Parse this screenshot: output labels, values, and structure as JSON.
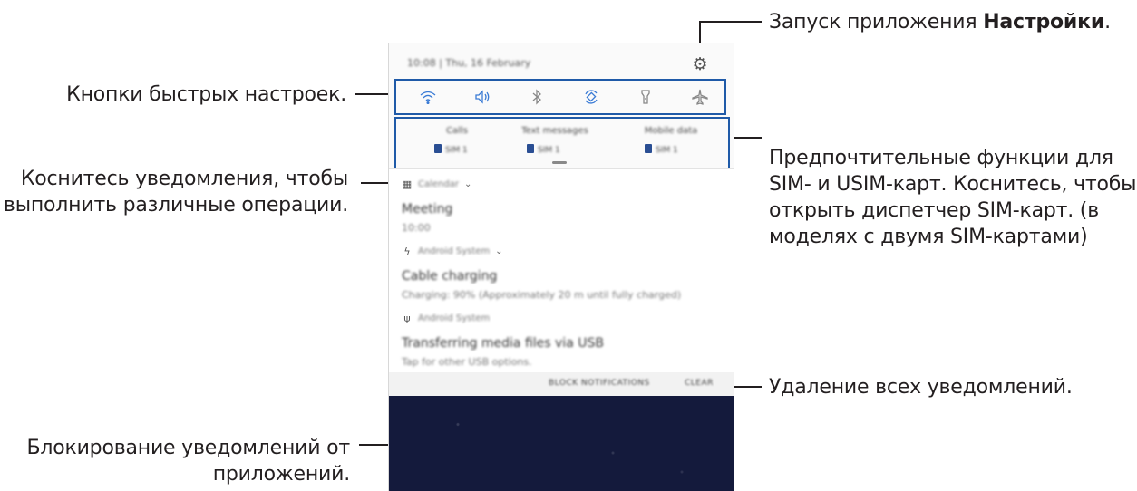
{
  "callouts": {
    "settings_text": "Запуск приложения ",
    "settings_bold": "Настройки",
    "settings_end": ".",
    "quick_settings": "Кнопки быстрых настроек.",
    "notification_tap_1": "Коснитесь уведомления, чтобы",
    "notification_tap_2": "выполнить различные операции.",
    "sim_1": "Предпочтительные функции для",
    "sim_2": "SIM- и USIM-карт. Коснитесь, чтобы",
    "sim_3": "открыть диспетчер SIM-карт. (в",
    "sim_4": "моделях с двумя SIM-картами)",
    "clear_all": "Удаление всех уведомлений.",
    "block_1": "Блокирование уведомлений от",
    "block_2": "приложений."
  },
  "phone": {
    "status_time": "10:08 | Thu, 16 February",
    "quick_settings": [
      "wifi-icon",
      "sound-icon",
      "bluetooth-icon",
      "auto-rotate-icon",
      "flashlight-icon",
      "airplane-mode-icon"
    ],
    "sim_items": [
      {
        "title": "Calls",
        "value": "SIM 1"
      },
      {
        "title": "Text messages",
        "value": "SIM 1"
      },
      {
        "title": "Mobile data",
        "value": "SIM 1"
      }
    ],
    "notifications": [
      {
        "app": "Calendar",
        "title": "Meeting",
        "sub": "10:00"
      },
      {
        "app": "Android System",
        "title": "Cable charging",
        "sub": "Charging: 90% (Approximately 20 m until fully charged)"
      },
      {
        "app": "Android System",
        "title": "Transferring media files via USB",
        "sub": "Tap for other USB options."
      }
    ],
    "block_label": "BLOCK NOTIFICATIONS",
    "clear_label": "CLEAR"
  },
  "colors": {
    "highlight_border": "#1f5aa8",
    "sim_icon": "#2a4e93",
    "wallpaper": "#141a3c"
  }
}
